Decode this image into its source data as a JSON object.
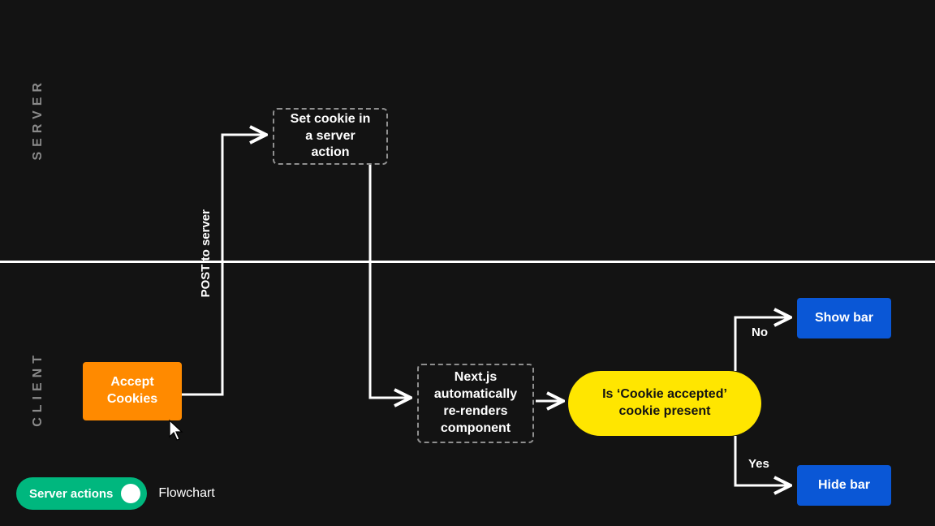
{
  "sections": {
    "server": "SERVER",
    "client": "CLIENT"
  },
  "nodes": {
    "accept": "Accept Cookies",
    "set_cookie": "Set cookie in a server action",
    "rerender": "Next.js automatically re-renders component",
    "decision": "Is ‘Cookie accepted’ cookie present",
    "show_bar": "Show bar",
    "hide_bar": "Hide bar"
  },
  "edges": {
    "post": "POST to server",
    "no": "No",
    "yes": "Yes"
  },
  "toggle": {
    "on_label": "Server actions",
    "off_label": "Flowchart"
  }
}
